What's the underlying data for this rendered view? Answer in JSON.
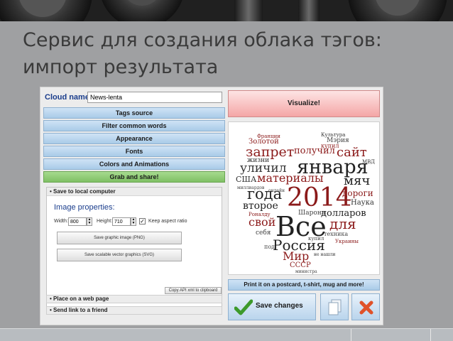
{
  "slide": {
    "title_line1": "Сервис для создания облака тэгов:",
    "title_line2": "импорт результата"
  },
  "app": {
    "cloud_name_label": "Cloud name:",
    "cloud_name_value": "News-lenta",
    "menu": {
      "tags_source": "Tags source",
      "filter_common_words": "Filter common words",
      "appearance": "Appearance",
      "fonts": "Fonts",
      "colors_animations": "Colors and Animations",
      "grab_share": "Grab and share!"
    },
    "save_local": {
      "header": "• Save to local computer",
      "image_properties": "Image properties:",
      "width_label": "Width:",
      "width_value": "800",
      "height_label": "Height:",
      "height_value": "710",
      "keep_aspect": "Keep aspect ratio",
      "keep_aspect_checked": true,
      "save_png": "Save graphic image (PNG)",
      "save_svg": "Save scalable vector graphics (SVG)",
      "copy_api": "Copy API xml to clipboard"
    },
    "place_web": "• Place on a web page",
    "send_link": "• Send link to a friend",
    "visualize": "Visualize!",
    "print": "Print it on a postcard, t-shirt, mug and more!",
    "save_changes": "Save changes",
    "accent_green": "#7fc064",
    "accent_blue": "#a9cbe8",
    "accent_red": "#f4a6a6"
  },
  "cloud": {
    "words": {
      "zapret": "запрет",
      "sait": "сайт",
      "ulichil": "уличил",
      "yanvarya": "января",
      "materialy": "материалы",
      "myach": "мяч",
      "goda": "года",
      "year": "2014",
      "vtoroe": "второе",
      "vse": "Все",
      "dlya": "для",
      "svoi": "свой",
      "rossiya": "Россия",
      "mir": "Мир",
      "dollarov": "долларов",
      "zolotoy": "Золотой",
      "poluchil": "получил",
      "ssha": "США",
      "dorogi": "дороги",
      "nauka": "Наука",
      "sssr": "СССР",
      "sharona": "Шарона",
      "tehnika": "техника",
      "ukrainy": "Украины",
      "sebya": "себя",
      "pod": "под",
      "kultura": "Культура",
      "mariya": "Мэрия",
      "kupil": "купил",
      "zhizni": "жизни",
      "mvd": "МВД",
      "milliardov": "миллиардов",
      "ronaldu": "Роналду",
      "nenashli": "не нашли",
      "ministra": "министра",
      "frantsii": "Франции",
      "onlajn": "онлайн"
    }
  }
}
